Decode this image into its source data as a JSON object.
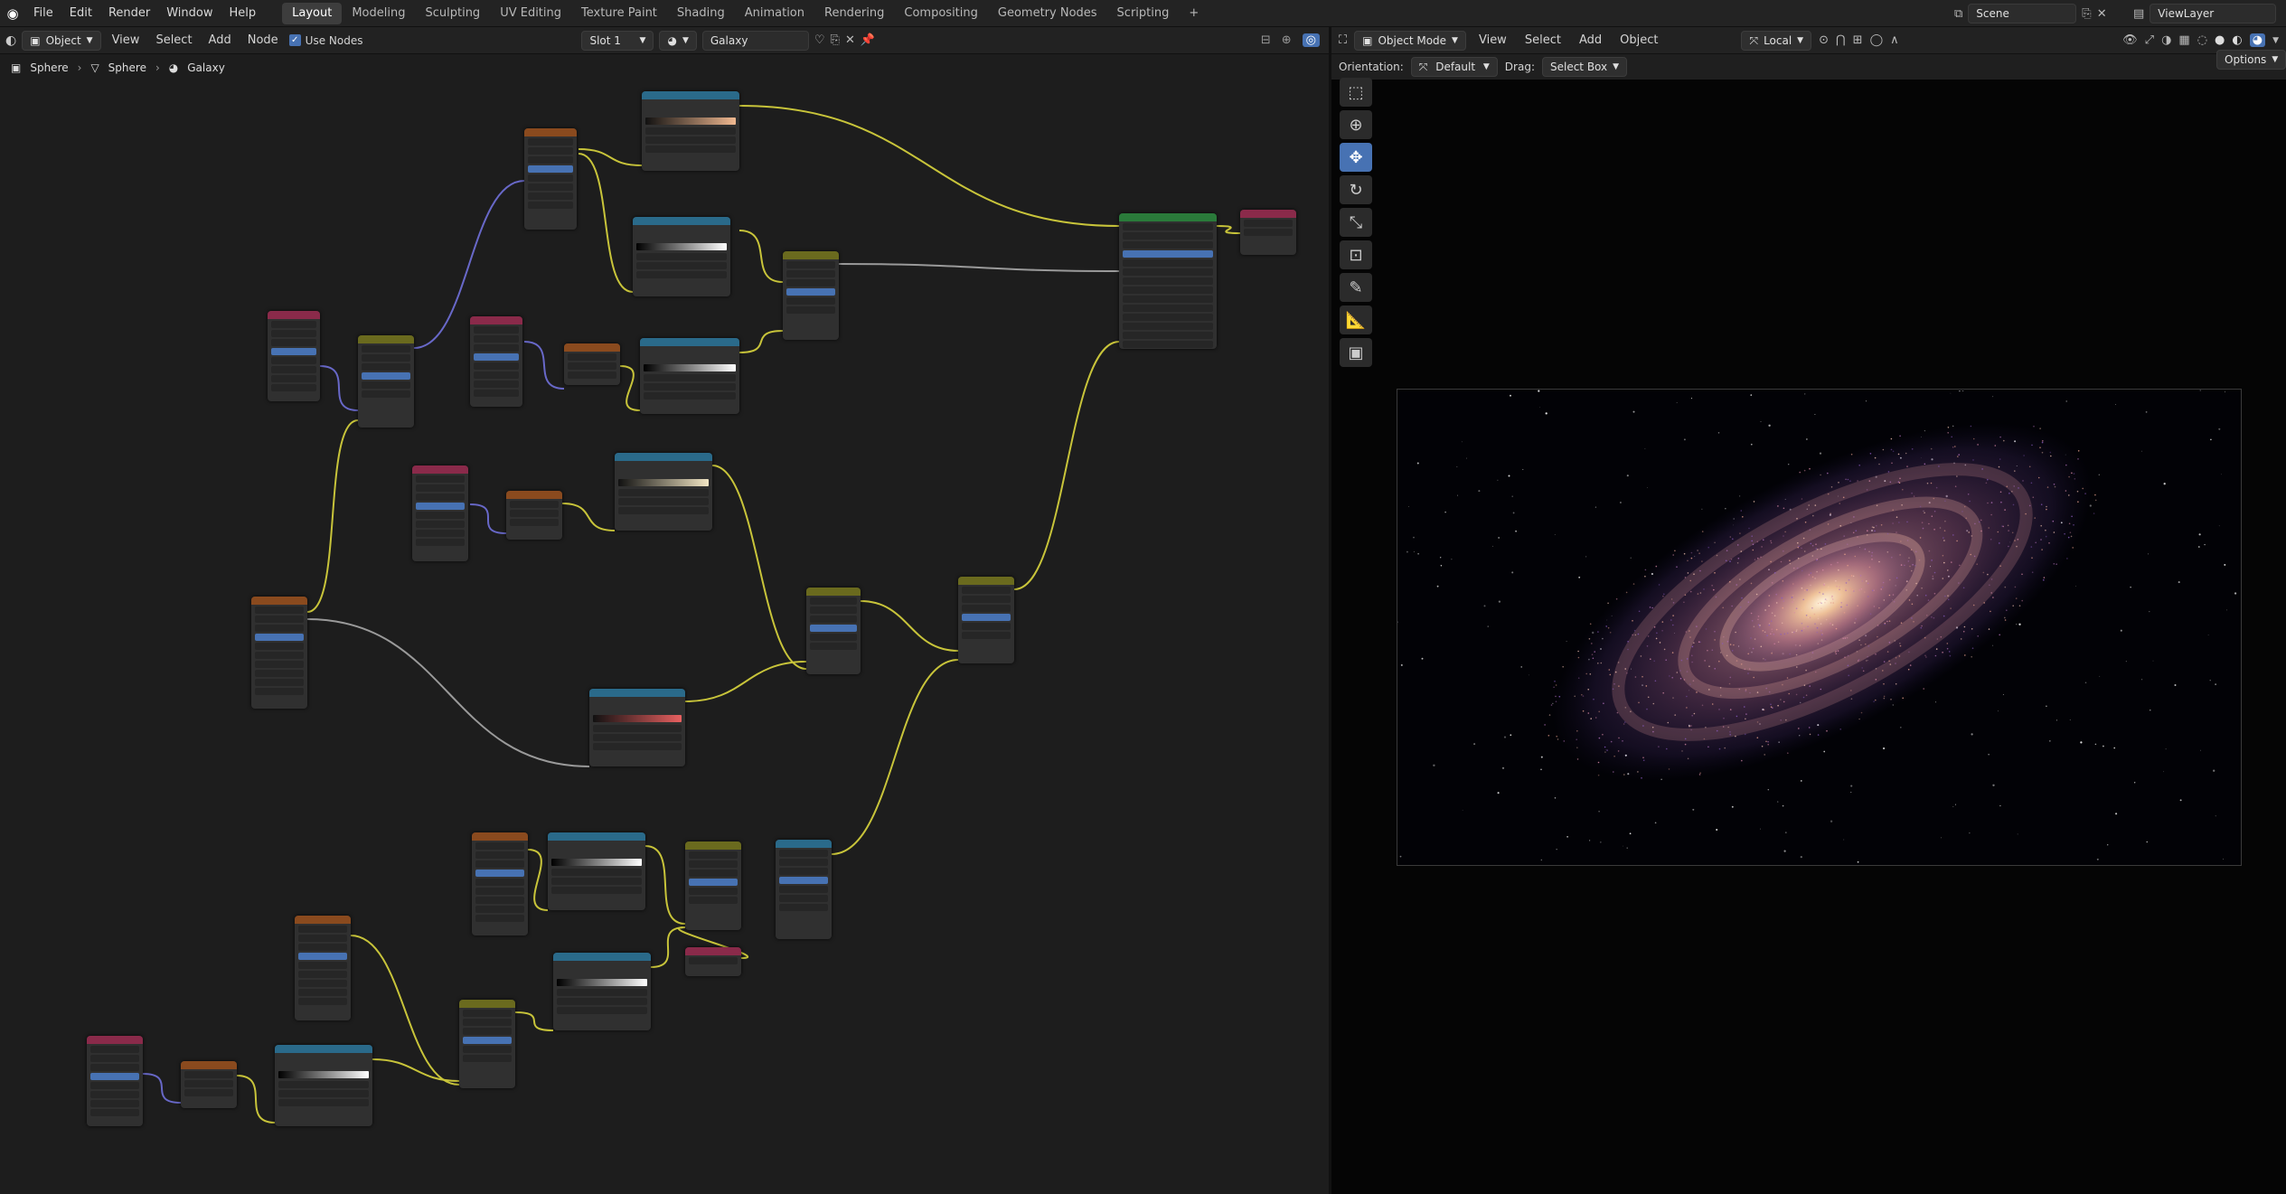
{
  "topbar": {
    "menus": [
      "File",
      "Edit",
      "Render",
      "Window",
      "Help"
    ],
    "workspaces": [
      "Layout",
      "Modeling",
      "Sculpting",
      "UV Editing",
      "Texture Paint",
      "Shading",
      "Animation",
      "Rendering",
      "Compositing",
      "Geometry Nodes",
      "Scripting"
    ],
    "active_workspace": "Layout",
    "add_tab_label": "+",
    "scene": "Scene",
    "view_layer": "ViewLayer"
  },
  "node_editor": {
    "object_mode": "Object",
    "menus": [
      "View",
      "Select",
      "Add",
      "Node"
    ],
    "use_nodes_label": "Use Nodes",
    "slot": "Slot 1",
    "material": "Galaxy",
    "breadcrumb": [
      "Sphere",
      "Sphere",
      "Galaxy"
    ]
  },
  "viewport": {
    "mode": "Object Mode",
    "menus": [
      "View",
      "Select",
      "Add",
      "Object"
    ],
    "transform_space": "Local",
    "orientation_label": "Orientation:",
    "orientation_value": "Default",
    "drag_label": "Drag:",
    "drag_value": "Select Box",
    "options_label": "Options"
  },
  "colors": {
    "accent": "#4772b3",
    "wire_yellow": "#c8c43a",
    "wire_grey": "#9a9a9a",
    "wire_purple": "#6868c8",
    "header_texture": "#8a4a1e",
    "header_input": "#8a2a4a",
    "header_converter": "#2a6a8a",
    "header_color": "#6a6a1e",
    "header_shader": "#2a7a3a"
  }
}
